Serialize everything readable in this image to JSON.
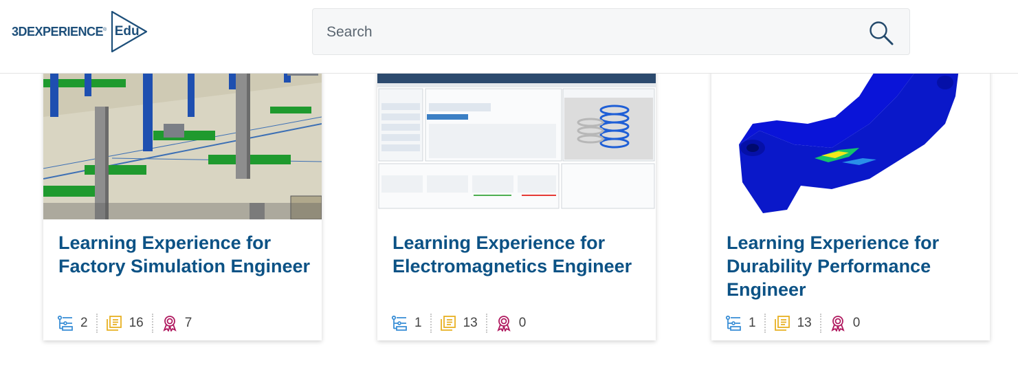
{
  "header": {
    "logo_main": "3DEXPERIENCE",
    "logo_reg": "®",
    "logo_edu": "Edu",
    "search_placeholder": "Search"
  },
  "colors": {
    "title": "#0c5285",
    "path_icon": "#3b8fd6",
    "content_icon": "#e8b021",
    "badge_icon": "#b0195f"
  },
  "cards": [
    {
      "title": "Learning Experience for Factory Simulation Engineer",
      "stats": {
        "paths": "2",
        "contents": "16",
        "badges": "7"
      },
      "image": "factory-simulation-scene"
    },
    {
      "title": "Learning Experience for Electromagnetics Engineer",
      "stats": {
        "paths": "1",
        "contents": "13",
        "badges": "0"
      },
      "image": "simulation-dashboard-screenshot"
    },
    {
      "title": "Learning Experience for Durability Performance Engineer",
      "stats": {
        "paths": "1",
        "contents": "13",
        "badges": "0"
      },
      "image": "stress-analysis-part"
    }
  ]
}
